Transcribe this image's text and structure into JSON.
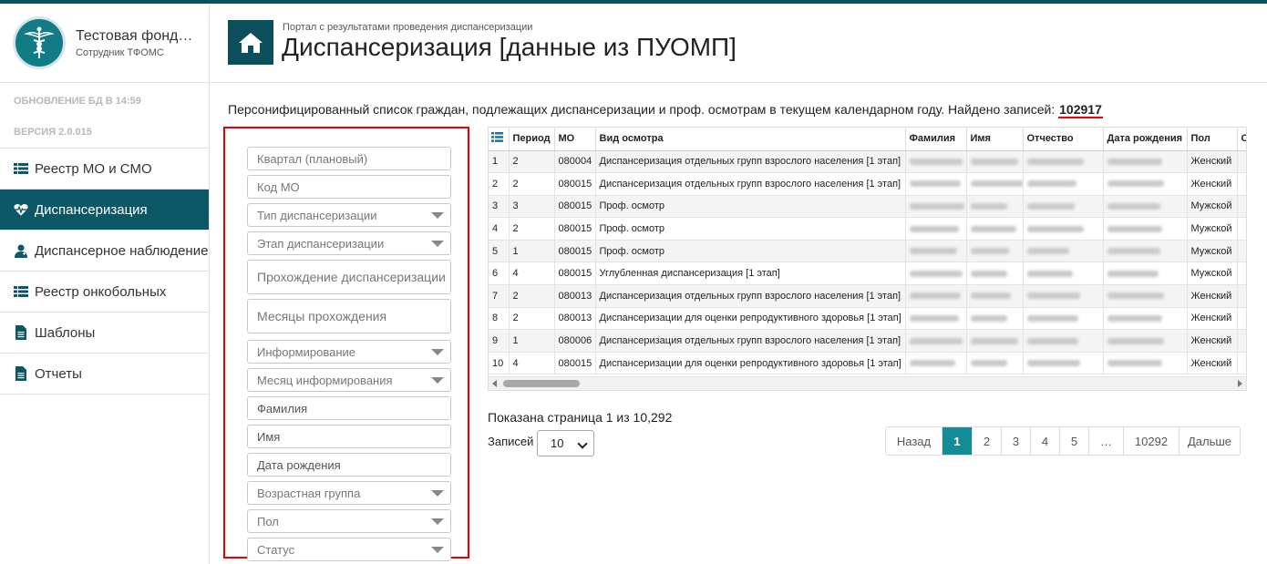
{
  "brand": {
    "title": "Тестовая фонд…",
    "subtitle": "Сотрудник ТФОМС",
    "logo_icon": "caduceus-icon"
  },
  "meta": {
    "db_update": "ОБНОВЛЕНИЕ БД В 14:59",
    "version": "ВЕРСИЯ 2.0.015"
  },
  "nav": [
    {
      "label": "Реестр МО и СМО",
      "icon": "list-icon",
      "active": false
    },
    {
      "label": "Диспансеризация",
      "icon": "heartbeat-icon",
      "active": true
    },
    {
      "label": "Диспансерное наблюдение",
      "icon": "user-medical-icon",
      "active": false
    },
    {
      "label": "Реестр онкобольных",
      "icon": "list-icon",
      "active": false
    },
    {
      "label": "Шаблоны",
      "icon": "file-icon",
      "active": false
    },
    {
      "label": "Отчеты",
      "icon": "file-icon",
      "active": false
    }
  ],
  "header": {
    "breadcrumb": "Портал с результатами проведения диспансеризации",
    "title": "Диспансеризация [данные из ПУОМП]",
    "home_icon": "home-icon"
  },
  "summary": {
    "text": "Персонифицированный список граждан, подлежащих диспансеризации и проф. осмотрам в текущем календарном году. Найдено записей:",
    "count": "102917"
  },
  "filters": {
    "quarter": "Квартал (плановый)",
    "mo_code": "Код МО",
    "type": "Тип диспансеризации",
    "stage": "Этап диспансеризации",
    "completion": "Прохождение диспансеризации",
    "months": "Месяцы прохождения",
    "informing": "Информирование",
    "inform_month": "Месяц информирования",
    "surname": "Фамилия",
    "name": "Имя",
    "birthdate": "Дата рождения",
    "age_group": "Возрастная группа",
    "sex": "Пол",
    "status": "Статус"
  },
  "table": {
    "columns": [
      "Период",
      "МО",
      "Вид осмотра",
      "Фамилия",
      "Имя",
      "Отчество",
      "Дата рождения",
      "Пол",
      "С"
    ],
    "rows": [
      {
        "n": "1",
        "period": "2",
        "mo": "080004",
        "type": "Диспансеризация отдельных групп взрослого населения [1 этап]",
        "sex": "Женский"
      },
      {
        "n": "2",
        "period": "2",
        "mo": "080015",
        "type": "Диспансеризация отдельных групп взрослого населения [1 этап]",
        "sex": "Женский"
      },
      {
        "n": "3",
        "period": "3",
        "mo": "080015",
        "type": "Проф. осмотр",
        "sex": "Мужской"
      },
      {
        "n": "4",
        "period": "2",
        "mo": "080015",
        "type": "Проф. осмотр",
        "sex": "Мужской"
      },
      {
        "n": "5",
        "period": "1",
        "mo": "080015",
        "type": "Проф. осмотр",
        "sex": "Мужской"
      },
      {
        "n": "6",
        "period": "4",
        "mo": "080015",
        "type": "Углубленная диспансеризация [1 этап]",
        "sex": "Мужской"
      },
      {
        "n": "7",
        "period": "2",
        "mo": "080013",
        "type": "Диспансеризация отдельных групп взрослого населения [1 этап]",
        "sex": "Женский"
      },
      {
        "n": "8",
        "period": "2",
        "mo": "080013",
        "type": "Диспансеризации для оценки репродуктивного здоровья [1 этап]",
        "sex": "Женский"
      },
      {
        "n": "9",
        "period": "1",
        "mo": "080006",
        "type": "Диспансеризация отдельных групп взрослого населения [1 этап]",
        "sex": "Женский"
      },
      {
        "n": "10",
        "period": "4",
        "mo": "080015",
        "type": "Диспансеризации для оценки репродуктивного здоровья [1 этап]",
        "sex": "Женский"
      }
    ]
  },
  "pagination": {
    "info": "Показана страница 1 из 10,292",
    "per_page_label": "Записей",
    "per_page_value": "10",
    "prev": "Назад",
    "pages": [
      "1",
      "2",
      "3",
      "4",
      "5",
      "…",
      "10292"
    ],
    "next": "Дальше",
    "active_color": "#138c96"
  }
}
